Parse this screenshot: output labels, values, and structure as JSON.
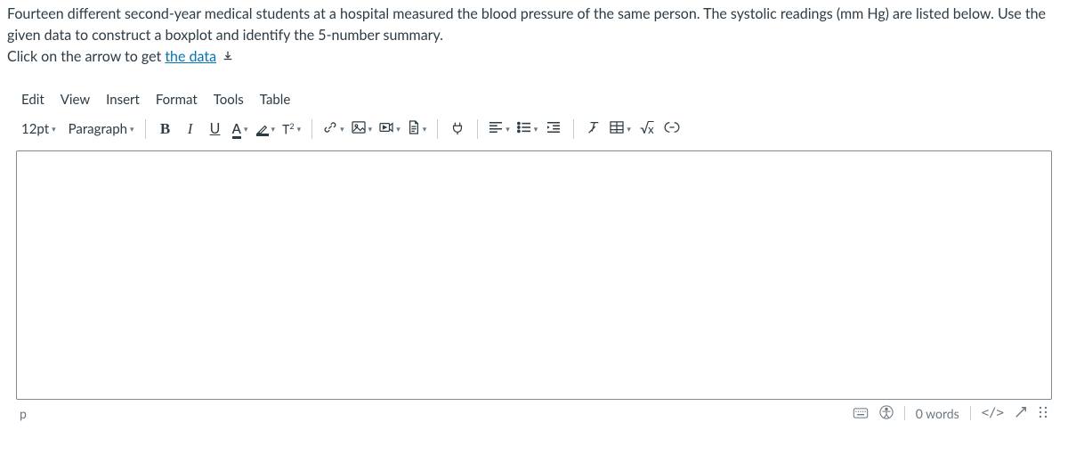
{
  "question": {
    "line1": "Fourteen different second-year medical students at a hospital measured the blood pressure of the same person. The systolic readings (mm Hg) are listed below. Use the",
    "line2": "given data to construct a boxplot and identify the 5-number summary.",
    "line3_prefix": "Click on the arrow to get ",
    "data_link": "the data"
  },
  "menubar": {
    "edit": "Edit",
    "view": "View",
    "insert": "Insert",
    "format": "Format",
    "tools": "Tools",
    "table": "Table"
  },
  "toolbar": {
    "font_size": "12pt",
    "block_format": "Paragraph",
    "bold": "B",
    "italic": "I",
    "underline": "U",
    "textcolor": "A",
    "superscript": "T",
    "superscript_exp": "2",
    "math_sqrt": "√",
    "math_var": "x"
  },
  "statusbar": {
    "path": "p",
    "wordcount": "0 words",
    "htmlview": "</>"
  }
}
